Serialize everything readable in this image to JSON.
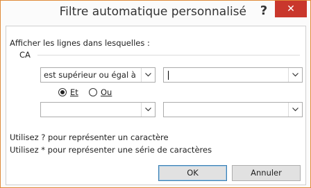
{
  "dialog": {
    "title": "Filtre automatique personnalisé",
    "help_label": "?",
    "close_label": "✕",
    "border_color": "#e08a39",
    "close_color": "#c9372c"
  },
  "content": {
    "intro": "Afficher les lignes dans lesquelles :",
    "field_name": "CA",
    "condition1": {
      "operator": "est supérieur ou égal à",
      "value": ""
    },
    "logic": {
      "and_label": "Et",
      "or_label": "Ou",
      "selected": "Et"
    },
    "condition2": {
      "operator": "",
      "value": ""
    },
    "hint1": "Utilisez ? pour représenter un caractère",
    "hint2": "Utilisez * pour représenter une série de caractères"
  },
  "buttons": {
    "ok": "OK",
    "cancel": "Annuler"
  }
}
